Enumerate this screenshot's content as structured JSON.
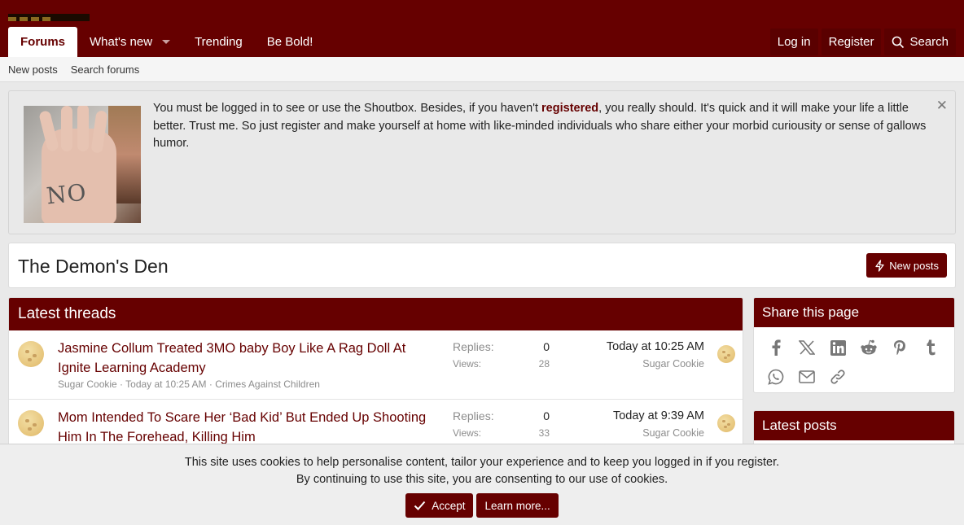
{
  "header": {
    "nav_tabs": [
      "Forums",
      "What's new",
      "Trending",
      "Be Bold!"
    ],
    "login": "Log in",
    "register": "Register",
    "search": "Search"
  },
  "subnav": {
    "links": [
      "New posts",
      "Search forums"
    ]
  },
  "notice": {
    "text_before": "You must be logged in to see or use the Shoutbox. Besides, if you haven't ",
    "bold": "registered",
    "text_after": ", you really should. It's quick and it will make your life a little better. Trust me. So just register and make yourself at home with like-minded individuals who share either your morbid curiousity or sense of gallows humor.",
    "image_text": "NO",
    "close_glyph": "✕"
  },
  "page": {
    "title": "The Demon's Den",
    "new_posts_button": "New posts"
  },
  "threads": {
    "heading": "Latest threads",
    "replies_label": "Replies:",
    "views_label": "Views:",
    "items": [
      {
        "title": "Jasmine Collum Treated 3MO baby Boy Like A Rag Doll At Ignite Learning Academy",
        "meta": "Sugar Cookie · Today at 10:25 AM · Crimes Against Children",
        "replies": "0",
        "views": "28",
        "last_time": "Today at 10:25 AM",
        "last_user": "Sugar Cookie"
      },
      {
        "title": "Mom Intended To Scare Her ‘Bad Kid’ But Ended Up Shooting Him In The Forehead, Killing Him",
        "meta": "",
        "replies": "0",
        "views": "33",
        "last_time": "Today at 9:39 AM",
        "last_user": "Sugar Cookie"
      }
    ]
  },
  "sidebar": {
    "share_heading": "Share this page",
    "share_icons": [
      "facebook-icon",
      "x-icon",
      "linkedin-icon",
      "reddit-icon",
      "pinterest-icon",
      "tumblr-icon",
      "whatsapp-icon",
      "email-icon",
      "link-icon"
    ],
    "latest_heading": "Latest posts"
  },
  "cookies": {
    "line1": "This site uses cookies to help personalise content, tailor your experience and to keep you logged in if you register.",
    "line2": "By continuing to use this site, you are consenting to our use of cookies.",
    "accept": "Accept",
    "learn_more": "Learn more..."
  },
  "colors": {
    "brand": "#660000",
    "link": "#660000",
    "muted": "#8c8c8c"
  }
}
